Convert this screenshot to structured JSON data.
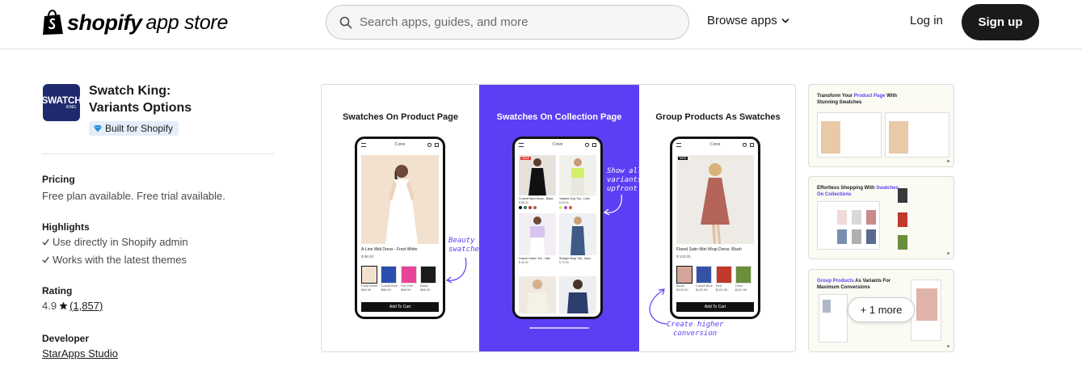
{
  "header": {
    "logo_word": "shopify",
    "logo_sub": "app store",
    "search_placeholder": "Search apps, guides, and more",
    "browse_label": "Browse apps",
    "login_label": "Log in",
    "signup_label": "Sign up"
  },
  "app": {
    "icon_text": "SWATCH",
    "icon_sub": "KING",
    "title_line1": "Swatch King:",
    "title_line2": "Variants Options",
    "badge": "Built for Shopify"
  },
  "details": {
    "pricing_label": "Pricing",
    "pricing_value": "Free plan available. Free trial available.",
    "highlights_label": "Highlights",
    "highlights": [
      "Use directly in Shopify admin",
      "Works with the latest themes"
    ],
    "rating_label": "Rating",
    "rating_value": "4.9",
    "rating_count": "(1,857)",
    "developer_label": "Developer",
    "developer_name": "StarApps Studio"
  },
  "screenshot": {
    "panel1": {
      "title": "Swatches On Product Page",
      "store": "Cove",
      "product": "A-Line Midi Dress - Frost White",
      "price": "$ 88.00",
      "thumbs": [
        "Frost White",
        "Cobalt Blue",
        "Hot Pink",
        "Black"
      ],
      "thumb_prices": [
        "$88.00",
        "$88.00",
        "$88.00",
        "$88.00"
      ],
      "selected_tag": "NEW",
      "cart": "Add To Cart",
      "note_line1": "Beauty",
      "note_line2": "swatches"
    },
    "panel2": {
      "title": "Swatches On Collection Page",
      "store": "Cove",
      "products": [
        "Crochet Maxi Dress - Black",
        "Twisted Crop Top - Lime",
        "Casual Cotton Tee - Lilac",
        "Straight Wrap Top - Navy"
      ],
      "prices": [
        "$ 88.00",
        "$ 65.00",
        "$ 45.00",
        "$ 72.00"
      ],
      "sale_tag": "SALE",
      "note_line1": "Show all",
      "note_line2": "variants",
      "note_line3": "upfront"
    },
    "panel3": {
      "title": "Group Products As Swatches",
      "store": "Cove",
      "product": "Flared Satin Mini Wrap Dress- Blush",
      "price": "$ 120.00",
      "tag": "NEW",
      "thumbs": [
        "Blush",
        "Cobalt Blue",
        "Red",
        "Olive"
      ],
      "thumb_prices": [
        "$120.00",
        "$120.00",
        "$120.00",
        "$120.00"
      ],
      "cart": "Add To Cart",
      "note_line1": "Create higher",
      "note_line2": "conversion"
    }
  },
  "thumbnails": {
    "t1_title_a": "Transform Your ",
    "t1_title_b": "Product Page",
    "t1_title_c": " With Stunning Swatches",
    "t2_title_a": "Effortless Shopping With ",
    "t2_title_b": "Swatches On Collections",
    "t3_title_a": "Group Products",
    "t3_title_b": " As Variants For Maximum Conversions",
    "more_label": "+ 1 more"
  },
  "colors": {
    "accent": "#5b3ff5",
    "dark": "#1a1a1a",
    "badge_bg": "#e4eef9",
    "icon_bg": "#1f2a6e"
  }
}
